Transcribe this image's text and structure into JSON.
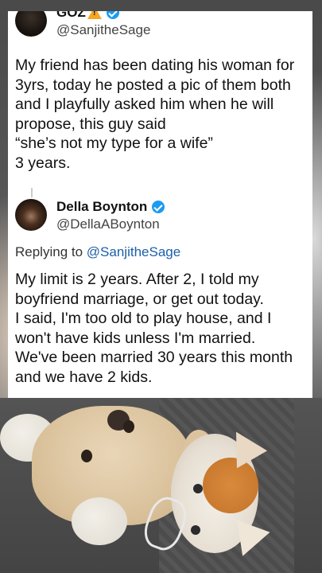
{
  "original_tweet": {
    "author_name": "GOZ",
    "author_name_emoji": "warning-emoji",
    "verified": true,
    "handle": "@SanjitheSage",
    "text": "My friend has been dating his woman for 3yrs, today he posted a pic of them both and I playfully asked him when he will propose, this guy said\n“she’s not my type for a wife”\n3 years."
  },
  "reply_tweet": {
    "author_name": "Della Boynton",
    "verified": true,
    "handle": "@DellaABoynton",
    "replying_to_label": "Replying to",
    "replying_to_handle": "@SanjitheSage",
    "text": "My limit is 2 years. After 2, I told my boyfriend marriage, or get out today.\nI said, I'm too old to play house, and I won't have kids unless I'm married.\nWe've been married 30 years this month and we have 2 kids."
  },
  "colors": {
    "verified_badge": "#1d9bf0",
    "mention_link": "#1d5fa8",
    "card_background": "#ffffff"
  },
  "photo": {
    "icon": "cat-with-plush-toy-image"
  }
}
